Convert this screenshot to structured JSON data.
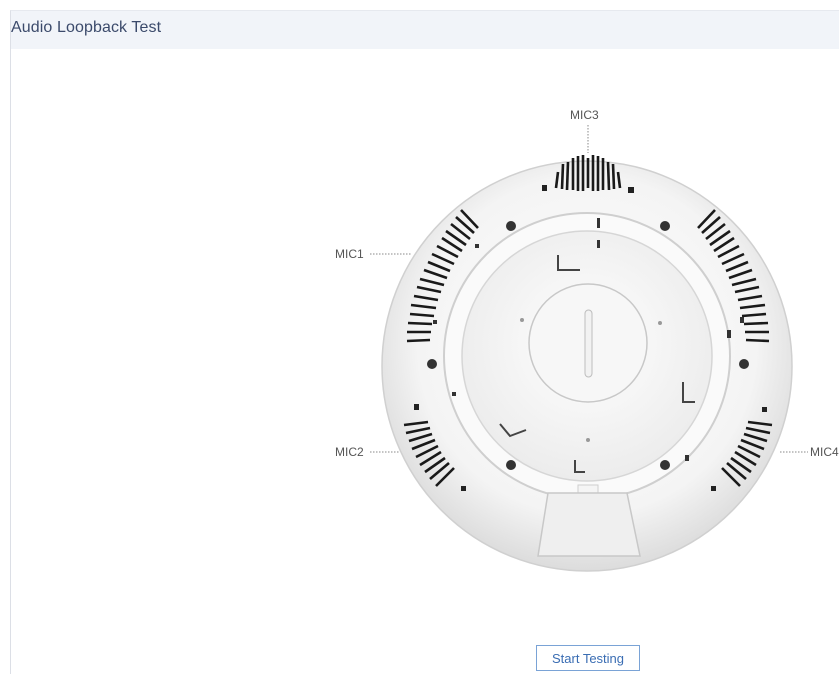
{
  "panel": {
    "title": "Audio Loopback Test"
  },
  "device": {
    "image": "ceiling-conference-speaker-bottom-view",
    "mics": [
      {
        "label": "MIC1"
      },
      {
        "label": "MIC2"
      },
      {
        "label": "MIC3"
      },
      {
        "label": "MIC4"
      }
    ]
  },
  "actions": {
    "start_label": "Start Testing"
  },
  "colors": {
    "header_bg": "#f1f4f9",
    "title_text": "#3b4a6b",
    "button_border": "#7aa3d6",
    "button_text": "#3a6db3"
  }
}
